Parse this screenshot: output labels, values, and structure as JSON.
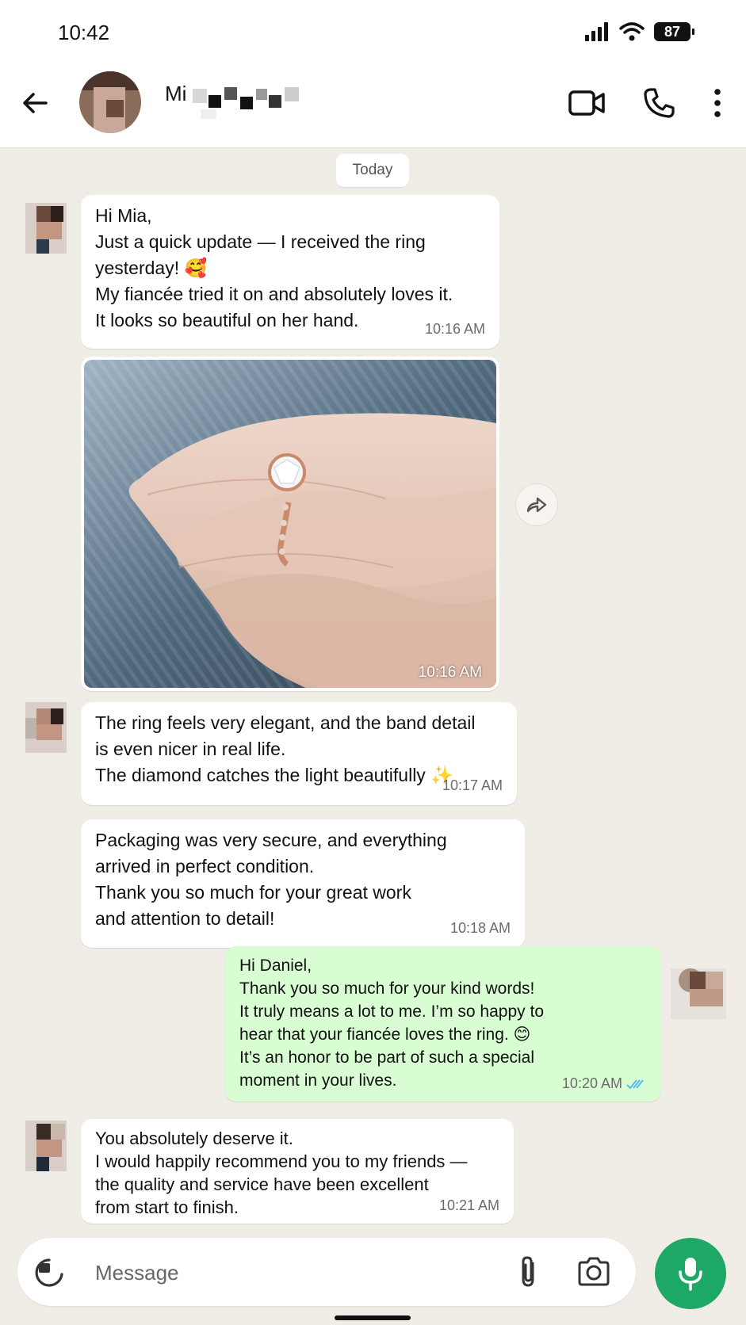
{
  "status_bar": {
    "time": "10:42",
    "battery": "87"
  },
  "header": {
    "contact_name": "Mi"
  },
  "chat": {
    "date_label": "Today",
    "messages": [
      {
        "text": "Hi Mia,\nJust a quick update — I received the ring\nyesterday! 🥰\nMy fiancée tried it on and absolutely loves it.\nIt looks so beautiful on her hand.",
        "time": "10:16 AM"
      },
      {
        "type": "image",
        "time": "10:16 AM"
      },
      {
        "text": "The ring feels very elegant, and the band detail\nis even nicer in real life.\nThe diamond catches the light beautifully ✨",
        "time": "10:17 AM"
      },
      {
        "text": "Packaging was very secure, and everything\narrived in perfect condition.\nThank you so much for your great work\nand attention to detail!",
        "time": "10:18 AM"
      },
      {
        "text": "Hi Daniel,\nThank you so much for your kind words!\nIt truly means a lot to me. I’m so happy to\nhear that your fiancée loves the ring. 😊\nIt’s an honor to be part of such a special\nmoment in your lives.",
        "time": "10:20 AM"
      },
      {
        "text": "You absolutely deserve it.\nI would happily recommend you to my friends —\nthe quality and service have been excellent\nfrom start to finish.",
        "time": "10:21 AM"
      }
    ]
  },
  "composer": {
    "placeholder": "Message"
  },
  "colors": {
    "outgoing_bubble": "#d9fdd3",
    "incoming_bubble": "#ffffff",
    "accent": "#1ea866",
    "read_ticks": "#53bdeb"
  }
}
